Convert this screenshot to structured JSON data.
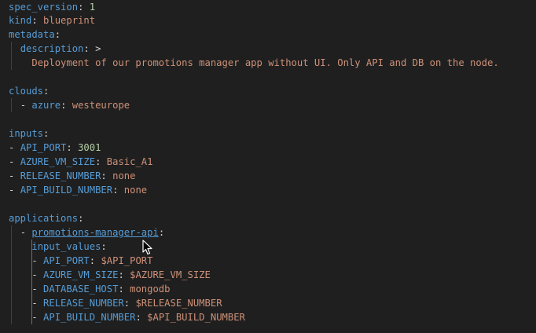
{
  "lines": {
    "l1": {
      "key": "spec_version",
      "value": "1"
    },
    "l2": {
      "key": "kind",
      "value": "blueprint"
    },
    "l3": {
      "key": "metadata"
    },
    "l4": {
      "key": "description",
      "value": ">"
    },
    "l5": {
      "text": "Deployment of our promotions manager app without UI. Only API and DB on the node."
    },
    "l7": {
      "key": "clouds"
    },
    "l8": {
      "key": "azure",
      "value": "westeurope"
    },
    "l10": {
      "key": "inputs"
    },
    "l11": {
      "key": "API_PORT",
      "value": "3001"
    },
    "l12": {
      "key": "AZURE_VM_SIZE",
      "value": "Basic_A1"
    },
    "l13": {
      "key": "RELEASE_NUMBER",
      "value": "none"
    },
    "l14": {
      "key": "API_BUILD_NUMBER",
      "value": "none"
    },
    "l16": {
      "key": "applications"
    },
    "l17": {
      "key": "promotions-manager-api"
    },
    "l18": {
      "key": "input_values"
    },
    "l19": {
      "key": "API_PORT",
      "value": "$API_PORT"
    },
    "l20": {
      "key": "AZURE_VM_SIZE",
      "value": "$AZURE_VM_SIZE"
    },
    "l21": {
      "key": "DATABASE_HOST",
      "value": "mongodb"
    },
    "l22": {
      "key": "RELEASE_NUMBER",
      "value": "$RELEASE_NUMBER"
    },
    "l23": {
      "key": "API_BUILD_NUMBER",
      "value": "$API_BUILD_NUMBER"
    }
  },
  "punct": {
    "colon": ":",
    "dash": "-"
  },
  "colors": {
    "background": "#1f1f1f",
    "key": "#569cd6",
    "string": "#ce9178",
    "number": "#b5cea8",
    "punctuation": "#d4d4d4"
  },
  "icons": {
    "mouse_cursor": "arrow-pointer-icon"
  }
}
